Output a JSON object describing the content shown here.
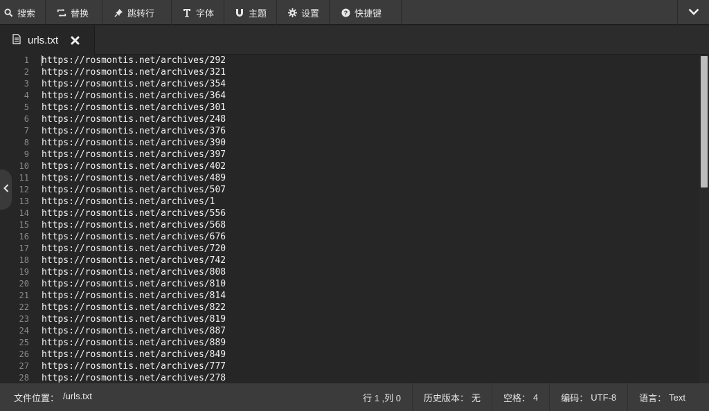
{
  "toolbar": {
    "items": [
      {
        "label": "搜索",
        "icon": "search-icon"
      },
      {
        "label": "替换",
        "icon": "replace-icon"
      },
      {
        "label": "跳转行",
        "icon": "pin-icon"
      },
      {
        "label": "字体",
        "icon": "font-icon"
      },
      {
        "label": "主题",
        "icon": "theme-icon"
      },
      {
        "label": "设置",
        "icon": "gear-icon"
      },
      {
        "label": "快捷键",
        "icon": "help-icon"
      }
    ],
    "collapse_icon": "chevron-down-icon"
  },
  "tab": {
    "filename": "urls.txt",
    "file_icon": "document-icon",
    "close_icon": "close-icon"
  },
  "editor": {
    "line_numbers": [
      "1",
      "2",
      "3",
      "4",
      "5",
      "6",
      "7",
      "8",
      "9",
      "10",
      "11",
      "12",
      "13",
      "14",
      "15",
      "16",
      "17",
      "18",
      "19",
      "20",
      "21",
      "22",
      "23",
      "24",
      "25",
      "26",
      "27",
      "28"
    ],
    "lines": [
      "https://rosmontis.net/archives/292",
      "https://rosmontis.net/archives/321",
      "https://rosmontis.net/archives/354",
      "https://rosmontis.net/archives/364",
      "https://rosmontis.net/archives/301",
      "https://rosmontis.net/archives/248",
      "https://rosmontis.net/archives/376",
      "https://rosmontis.net/archives/390",
      "https://rosmontis.net/archives/397",
      "https://rosmontis.net/archives/402",
      "https://rosmontis.net/archives/489",
      "https://rosmontis.net/archives/507",
      "https://rosmontis.net/archives/1",
      "https://rosmontis.net/archives/556",
      "https://rosmontis.net/archives/568",
      "https://rosmontis.net/archives/676",
      "https://rosmontis.net/archives/720",
      "https://rosmontis.net/archives/742",
      "https://rosmontis.net/archives/808",
      "https://rosmontis.net/archives/810",
      "https://rosmontis.net/archives/814",
      "https://rosmontis.net/archives/822",
      "https://rosmontis.net/archives/819",
      "https://rosmontis.net/archives/887",
      "https://rosmontis.net/archives/889",
      "https://rosmontis.net/archives/849",
      "https://rosmontis.net/archives/777",
      "https://rosmontis.net/archives/278"
    ]
  },
  "status": {
    "path_label": "文件位置：",
    "path": "/urls.txt",
    "position": "行 1 ,列 0",
    "history_label": "历史版本：",
    "history_value": "无",
    "indent_label": "空格：",
    "indent_value": "4",
    "encoding_label": "编码：",
    "encoding_value": "UTF-8",
    "language_label": "语言：",
    "language_value": "Text"
  },
  "colors": {
    "toolbar_bg": "#3b3b3b",
    "editor_bg": "#262626",
    "text": "#f2f2f2",
    "line_number": "#8a8a8a"
  }
}
